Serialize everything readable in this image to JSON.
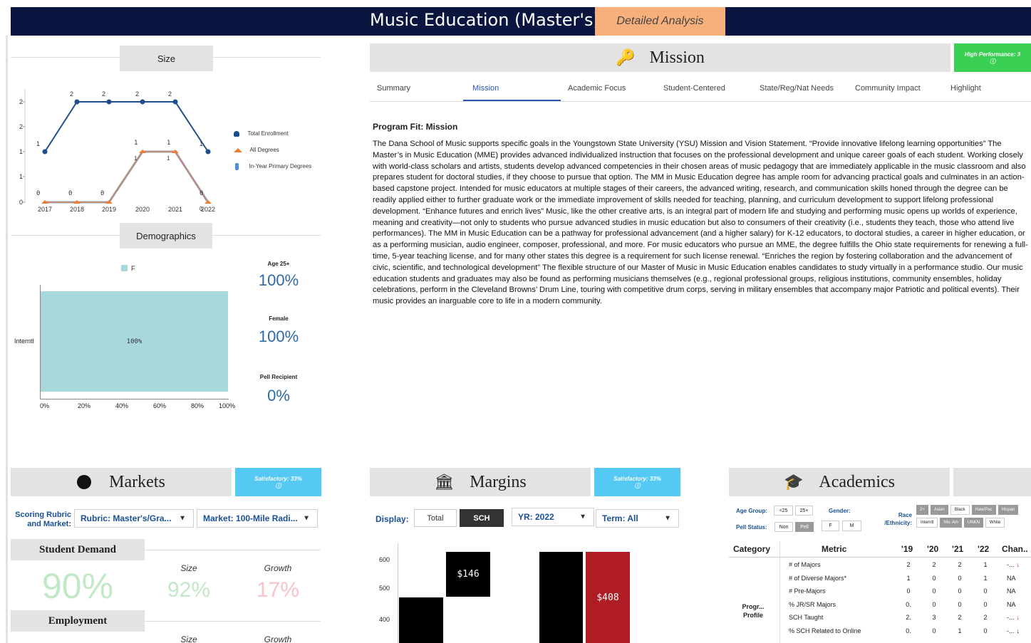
{
  "header": {
    "title": "Music Education (Master's)",
    "detail_button": "Detailed Analysis"
  },
  "size": {
    "title": "Size",
    "legend": [
      "Total Enrollment",
      "All Degrees",
      "In-Year Primary Degrees"
    ],
    "y_ticks": [
      "2",
      "2",
      "1",
      "1",
      "0"
    ],
    "x_ticks": [
      "2017",
      "2018",
      "2019",
      "2020",
      "2021",
      "2022"
    ]
  },
  "chart_data": {
    "type": "line",
    "categories": [
      "2017",
      "2018",
      "2019",
      "2020",
      "2021",
      "2022"
    ],
    "series": [
      {
        "name": "Total Enrollment",
        "values": [
          1,
          2,
          2,
          2,
          2,
          1
        ],
        "labels": [
          "1",
          "2",
          "2",
          "2",
          "2",
          "1"
        ]
      },
      {
        "name": "All Degrees",
        "values": [
          0,
          0,
          0,
          1,
          1,
          0
        ],
        "labels": [
          "0",
          "0",
          "0",
          "1",
          "1",
          "0"
        ]
      },
      {
        "name": "In-Year Primary Degrees",
        "values": [
          0,
          0,
          0,
          1,
          1,
          0
        ],
        "labels": [
          "",
          "",
          "",
          "1",
          "1",
          "0"
        ]
      }
    ],
    "colors": {
      "Total Enrollment": "#1f4e8c",
      "All Degrees": "#f07c2d",
      "In-Year Primary Degrees": "#8fa3c4"
    }
  },
  "demographics": {
    "title": "Demographics",
    "legend_label": "F",
    "bar_category": "Interntl",
    "bar_value_label": "100%",
    "bar_fraction": 1.0,
    "x_ticks": [
      "0%",
      "20%",
      "40%",
      "60%",
      "80%",
      "100%"
    ],
    "stats": [
      {
        "label": "Age 25+",
        "value": "100%"
      },
      {
        "label": "Female",
        "value": "100%"
      },
      {
        "label": "Pell Recipient",
        "value": "0%"
      }
    ]
  },
  "mission": {
    "title": "Mission",
    "badge": "High Performance: 3",
    "tabs": [
      "Summary",
      "Mission",
      "Academic Focus",
      "Student-Centered",
      "State/Reg/Nat Needs",
      "Community Impact",
      "Highlight"
    ],
    "active_tab": "Mission",
    "heading": "Program Fit: Mission",
    "body": "The Dana School of Music supports specific goals in the Youngstown State University (YSU) Mission and Vision Statement. “Provide innovative lifelong learning opportunities” The Master’s in Music Education (MME) provides advanced individualized instruction that focuses on the professional development and unique career goals of each student. Working closely with world-class scholars and artists, students develop advanced competencies in their chosen areas of music pedagogy that are immediately applicable in the music classroom and also prepares student for doctoral studies, if they choose to pursue that option. The MM in Music Education degree has ample room for advancing practical goals and culminates in an action-based capstone project. Intended for music educators at multiple stages of their careers, the advanced writing, research, and communication skills honed through the degree can be readily applied either to further graduate work or the immediate improvement of skills needed for teaching, planning, and curriculum development to support lifelong professional development. “Enhance futures and enrich lives” Music, like the other creative arts, is an integral part of modern life and studying and performing music opens up worlds of experience, meaning and creativity—not only to students who pursue advanced studies in music education but also to consumers of their creativity (i.e., students they teach, those who attend live performances). The MM in Music Education can be a pathway for professional advancement (and a higher salary) for K-12 educators, to doctoral studies, a career in higher education, or as a performing musician, audio engineer, composer, professional, and more. For music educators who pursue an MME, the degree fulfills the Ohio state requirements for renewing a full-time, 5-year teaching license, and for many other states this degree is a requirement for such license renewal. “Enriches the region by fostering collaboration and the advancement of civic, scientific, and technological development” The flexible structure of our Master of Music in Music Education enables candidates to study virtually in a performance studio. Our music education students and graduates may also be found as performing musicians themselves (e.g., regional professional groups, religious institutions, community ensembles, holiday celebrations, perform in the Cleveland Browns’ Drum Line, touring with competitive drum corps, serving in military ensembles that accompany major Patriotic and political events). Their music provides an inarguable core to life in a modern community."
  },
  "markets": {
    "title": "Markets",
    "badge": "Satisfactory: 33%",
    "rubric_label": "Scoring Rubric and Market:",
    "rubric_select": "Rubric: Master's/Gra...",
    "market_select": "Market: 100-Mile Radi...",
    "demand_title": "Student Demand",
    "demand_score": "90%",
    "size_label": "Size",
    "growth_label": "Growth",
    "demand_size": "92%",
    "demand_growth": "17%",
    "employment_title": "Employment",
    "emp_size_label": "Size",
    "emp_growth_label": "Growth"
  },
  "margins": {
    "title": "Margins",
    "badge": "Satisfactory: 33%",
    "display_label": "Display:",
    "toggle": [
      "Total",
      "SCH"
    ],
    "active_toggle": "SCH",
    "year_select": "YR: 2022",
    "term_select": "Term: All",
    "y_ticks": [
      "600",
      "500",
      "400"
    ],
    "bar_labels": [
      "$146",
      "$408"
    ]
  },
  "academics": {
    "title": "Academics",
    "filters": {
      "age_label": "Age Group:",
      "age_opts": [
        "<25",
        "25+"
      ],
      "gender_label": "Gender:",
      "gender_opts": [
        "F",
        "M"
      ],
      "pell_label": "Pell Status:",
      "pell_opts": [
        "Non",
        "Pell"
      ],
      "race_label": "Race /Ethnicity:",
      "race_row1": [
        "2+",
        "Asian",
        "Black",
        "Haw/Pac",
        "Hispan"
      ],
      "race_row2": [
        "Interntl",
        "Ntv. Am",
        "UNKN",
        "White"
      ]
    },
    "table": {
      "headers": [
        "Category",
        "Metric",
        "'19",
        "'20",
        "'21",
        "'22",
        "Chan.."
      ],
      "category": "Progr... Profile",
      "rows": [
        {
          "metric": "# of Majors",
          "v": [
            "2",
            "2",
            "2",
            "1"
          ],
          "chg": "-...",
          "arrow": "down-red"
        },
        {
          "metric": "# of Diverse Majors*",
          "v": [
            "1",
            "0",
            "0",
            "1"
          ],
          "chg": "NA",
          "arrow": ""
        },
        {
          "metric": "# Pre-Majors",
          "v": [
            "0",
            "0",
            "0",
            "0"
          ],
          "chg": "NA",
          "arrow": ""
        },
        {
          "metric": "% JR/SR Majors",
          "v": [
            "0.",
            "0",
            "0",
            "0"
          ],
          "chg": "NA",
          "arrow": ""
        },
        {
          "metric": "SCH Taught",
          "v": [
            "2.",
            "3",
            "2",
            "2"
          ],
          "chg": "-...",
          "arrow": "down-red"
        },
        {
          "metric": "% SCH Related to Online",
          "v": [
            "0.",
            "0",
            "1",
            "0"
          ],
          "chg": "-...",
          "arrow": "down-dark"
        }
      ]
    }
  }
}
